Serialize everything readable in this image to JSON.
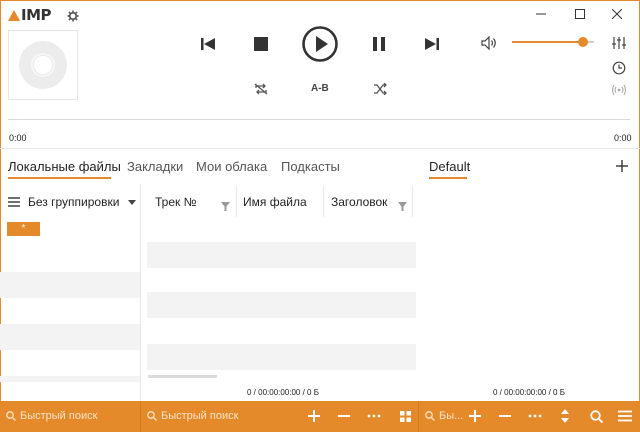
{
  "app": {
    "logo_text": "IMP"
  },
  "player": {
    "time_elapsed": "0:00",
    "time_total": "0:00",
    "ab_label": "A-B",
    "volume_fraction": 0.86
  },
  "tabs": {
    "left": [
      "Локальные файлы",
      "Закладки",
      "Мои облака",
      "Подкасты"
    ],
    "playlist": "Default"
  },
  "grouping": {
    "label": "Без группировки"
  },
  "group_badge": "*",
  "columns": [
    "Трек №",
    "Имя файла",
    "Заголовок"
  ],
  "status": {
    "left": "0 / 00:00:00:00 / 0 Б",
    "right": "0 / 00:00:00:00 / 0 Б"
  },
  "footer": {
    "search1": "Быстрый поиск",
    "search2": "Быстрый поиск",
    "search3": "Бы..."
  },
  "colors": {
    "accent": "#e48a2a"
  }
}
